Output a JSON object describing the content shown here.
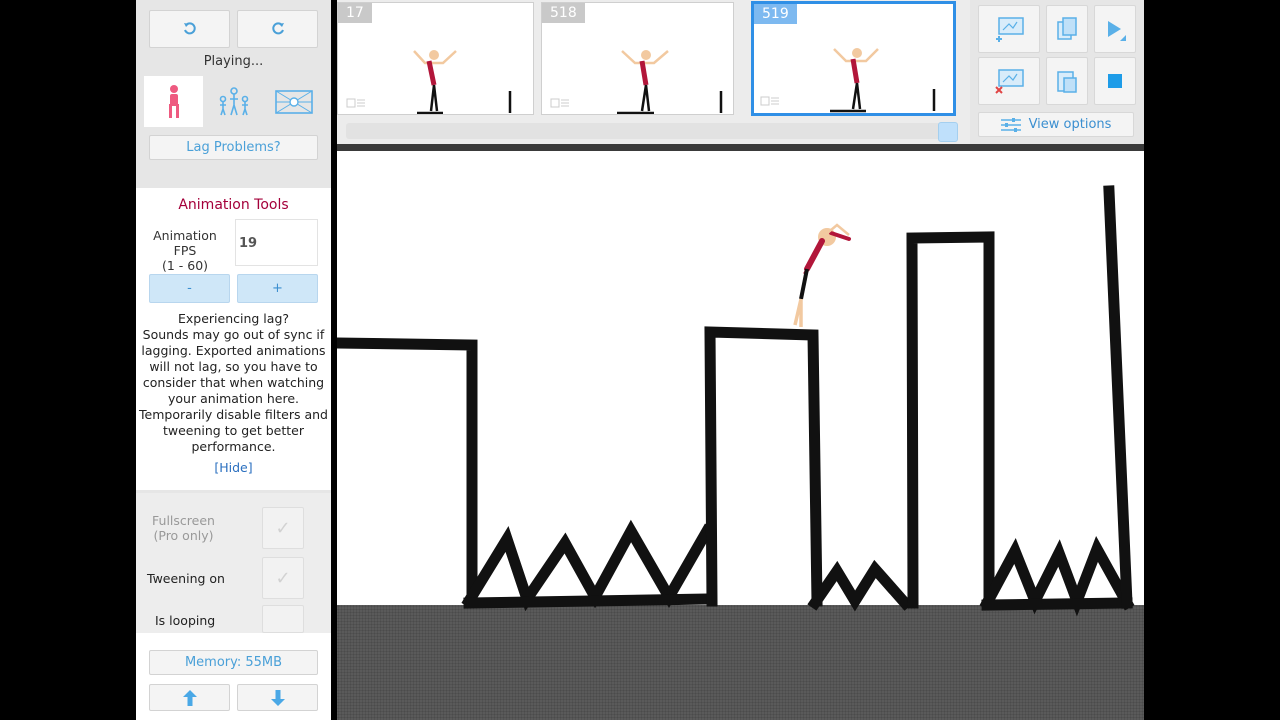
{
  "left_panel": {
    "status": "Playing...",
    "lag_button": "Lag Problems?",
    "animation_tools": {
      "title": "Animation Tools",
      "fps_label_1": "Animation FPS",
      "fps_label_2": "(1 - 60)",
      "fps_value": "19",
      "minus": "-",
      "plus": "+"
    },
    "lag_info": {
      "title": "Experiencing lag?",
      "lines": [
        "Sounds may go out of sync if",
        "lagging. Exported animations",
        "will not lag, so you have to",
        "consider that when watching",
        "your animation here.",
        "Temporarily disable filters and",
        "tweening to get better",
        "performance."
      ],
      "hide_link": "[Hide]"
    },
    "options": {
      "fullscreen_1": "Fullscreen",
      "fullscreen_2": "(Pro only)",
      "tweening": "Tweening on",
      "looping": "Is looping"
    },
    "memory": "Memory: 55MB"
  },
  "timeline": {
    "frames": [
      {
        "number": "17"
      },
      {
        "number": "518"
      },
      {
        "number": "519"
      }
    ],
    "selected_frame": "519"
  },
  "toolbar": {
    "view_options": "View options"
  },
  "colors": {
    "accent_blue": "#2f8fe6",
    "title_red": "#a4003a",
    "stick_red": "#b2163a",
    "skin": "#f2c9a0"
  }
}
